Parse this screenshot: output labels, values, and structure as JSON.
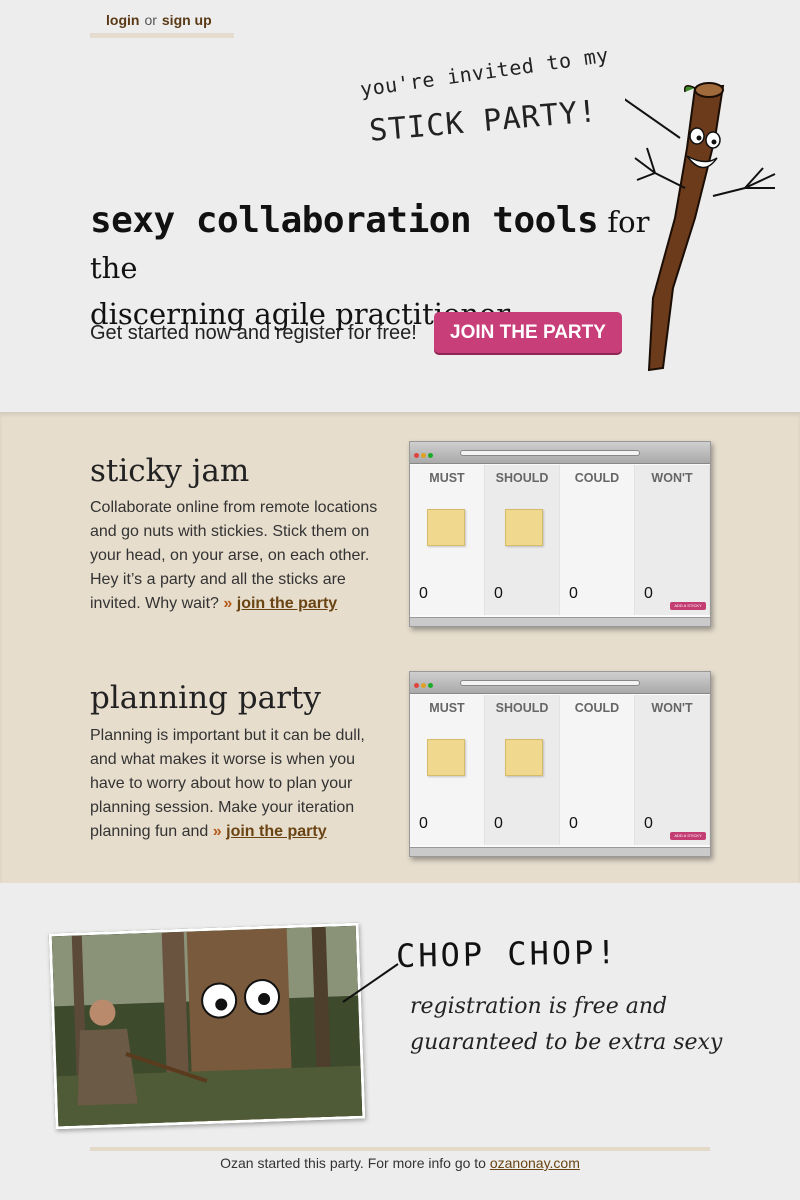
{
  "auth": {
    "login": "login",
    "or": "or",
    "signup": "sign up"
  },
  "hero": {
    "invite_line1": "you're invited to my",
    "invite_line2": "STICK PARTY!",
    "title_bold": "sexy collaboration tools",
    "title_rest_1": " for the",
    "title_rest_2": "discerning agile practitioner",
    "register_text": "Get started now and register for free!",
    "join_button": "JOIN THE PARTY"
  },
  "features": [
    {
      "title": "sticky jam",
      "text": "Collaborate online from remote locations and go nuts with stickies. Stick them on your head, on your arse, on each other. Hey it’s a party and all the sticks are invited. Why wait?",
      "link_prefix": "»",
      "link": "join the party"
    },
    {
      "title": "planning party",
      "text": "Planning is important but it can be dull, and what makes it worse is when you have to worry about how to plan your planning session. Make your iteration planning fun and",
      "link_prefix": "»",
      "link": "join the party"
    }
  ],
  "board": {
    "columns": [
      "MUST",
      "SHOULD",
      "COULD",
      "WON'T"
    ],
    "counts": [
      "0",
      "0",
      "0",
      "0"
    ],
    "add_button": "ADD A STICKY"
  },
  "bottom": {
    "chop": "CHOP CHOP!",
    "reg_line1": "registration is free and",
    "reg_line2": "guaranteed to be extra sexy"
  },
  "footer": {
    "text": "Ozan started this party. For more info go to ",
    "link": "ozanonay.com"
  },
  "colors": {
    "background": "#ededed",
    "band": "#e6ddcd",
    "button": "#c83e78",
    "link": "#6a4413",
    "sticky": "#f0d88f"
  }
}
